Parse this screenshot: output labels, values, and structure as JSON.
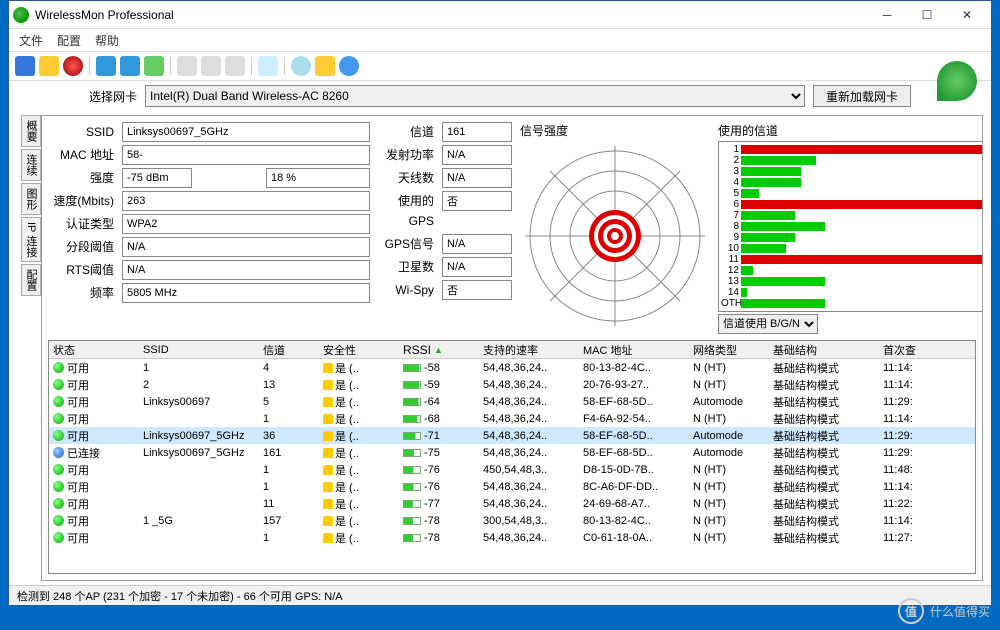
{
  "window": {
    "title": "WirelessMon Professional"
  },
  "menu": {
    "file": "文件",
    "config": "配置",
    "help": "帮助"
  },
  "adapter": {
    "label": "选择网卡",
    "value": "Intel(R) Dual Band Wireless-AC 8260",
    "reload": "重新加载网卡"
  },
  "fields": {
    "ssid_l": "SSID",
    "ssid": "Linksys00697_5GHz",
    "mac_l": "MAC 地址",
    "mac": "58-",
    "str_l": "强度",
    "str": "-75 dBm",
    "str_pct": "18 %",
    "spd_l": "速度(Mbits)",
    "spd": "263",
    "auth_l": "认证类型",
    "auth": "WPA2",
    "frag_l": "分段阈值",
    "frag": "N/A",
    "rts_l": "RTS阈值",
    "rts": "N/A",
    "freq_l": "频率",
    "freq": "5805 MHz",
    "chan_l": "信道",
    "chan": "161",
    "txp_l": "发射功率",
    "txp": "N/A",
    "ant_l": "天线数",
    "ant": "N/A",
    "gps_l": "使用的GPS",
    "gps": "否",
    "gpss_l": "GPS信号",
    "gpss": "N/A",
    "sat_l": "卫星数",
    "sat": "N/A",
    "wispy_l": "Wi-Spy",
    "wispy": "否"
  },
  "groups": {
    "signal": "信号强度",
    "channels": "使用的信道",
    "chmode": "信道使用 B/G/N"
  },
  "chart_data": {
    "type": "bar",
    "title": "使用的信道",
    "xlabel": "",
    "ylabel": "",
    "categories": [
      "1",
      "2",
      "3",
      "4",
      "5",
      "6",
      "7",
      "8",
      "9",
      "10",
      "11",
      "12",
      "13",
      "14",
      "OTH"
    ],
    "values": [
      100,
      25,
      20,
      20,
      6,
      95,
      18,
      28,
      18,
      15,
      98,
      4,
      28,
      2,
      28
    ],
    "colors": [
      "#d00",
      "#0c0",
      "#0c0",
      "#0c0",
      "#0c0",
      "#d00",
      "#0c0",
      "#0c0",
      "#0c0",
      "#0c0",
      "#d00",
      "#0c0",
      "#0c0",
      "#0c0",
      "#0c0"
    ]
  },
  "cols": {
    "status": "状态",
    "ssid": "SSID",
    "chan": "信道",
    "sec": "安全性",
    "rssi": "RSSI",
    "rates": "支持的速率",
    "mac": "MAC 地址",
    "net": "网络类型",
    "infra": "基础结构",
    "first": "首次查"
  },
  "sec_yes": "是 (..",
  "rows": [
    {
      "st": "可用",
      "d": "g",
      "ss": "1",
      "ch": "4",
      "rs": -58,
      "rt": "54,48,36,24..",
      "mac": "80-13-82-4C..",
      "net": "N (HT)",
      "inf": "基础结构模式",
      "t": "11:14:"
    },
    {
      "st": "可用",
      "d": "g",
      "ss": "2",
      "ch": "13",
      "rs": -59,
      "rt": "54,48,36,24..",
      "mac": "20-76-93-27..",
      "net": "N (HT)",
      "inf": "基础结构模式",
      "t": "11:14:"
    },
    {
      "st": "可用",
      "d": "g",
      "ss": "Linksys00697",
      "ch": "5",
      "rs": -64,
      "rt": "54,48,36,24..",
      "mac": "58-EF-68-5D..",
      "net": "Automode",
      "inf": "基础结构模式",
      "t": "11:29:"
    },
    {
      "st": "可用",
      "d": "g",
      "ss": "",
      "ch": "1",
      "rs": -68,
      "rt": "54,48,36,24..",
      "mac": "F4-6A-92-54..",
      "net": "N (HT)",
      "inf": "基础结构模式",
      "t": "11:14:"
    },
    {
      "st": "可用",
      "d": "g",
      "ss": "Linksys00697_5GHz",
      "ch": "36",
      "rs": -71,
      "rt": "54,48,36,24..",
      "mac": "58-EF-68-5D..",
      "net": "Automode",
      "inf": "基础结构模式",
      "t": "11:29:",
      "sel": true
    },
    {
      "st": "已连接",
      "d": "b",
      "ss": "Linksys00697_5GHz",
      "ch": "161",
      "rs": -75,
      "rt": "54,48,36,24..",
      "mac": "58-EF-68-5D..",
      "net": "Automode",
      "inf": "基础结构模式",
      "t": "11:29:"
    },
    {
      "st": "可用",
      "d": "g",
      "ss": "",
      "ch": "1",
      "rs": -76,
      "rt": "450,54,48,3..",
      "mac": "D8-15-0D-7B..",
      "net": "N (HT)",
      "inf": "基础结构模式",
      "t": "11:48:"
    },
    {
      "st": "可用",
      "d": "g",
      "ss": "",
      "ch": "1",
      "rs": -76,
      "rt": "54,48,36,24..",
      "mac": "8C-A6-DF-DD..",
      "net": "N (HT)",
      "inf": "基础结构模式",
      "t": "11:14:"
    },
    {
      "st": "可用",
      "d": "g",
      "ss": "",
      "ch": "11",
      "rs": -77,
      "rt": "54,48,36,24..",
      "mac": "24-69-68-A7..",
      "net": "N (HT)",
      "inf": "基础结构模式",
      "t": "11:22:"
    },
    {
      "st": "可用",
      "d": "g",
      "ss": "1       _5G",
      "ch": "157",
      "rs": -78,
      "rt": "300,54,48,3..",
      "mac": "80-13-82-4C..",
      "net": "N (HT)",
      "inf": "基础结构模式",
      "t": "11:14:"
    },
    {
      "st": "可用",
      "d": "g",
      "ss": "",
      "ch": "1",
      "rs": -78,
      "rt": "54,48,36,24..",
      "mac": "C0-61-18-0A..",
      "net": "N (HT)",
      "inf": "基础结构模式",
      "t": "11:27:"
    }
  ],
  "statusbar": "检测到 248 个AP (231 个加密 - 17 个未加密) - 66 个可用 GPS: N/A",
  "watermark": {
    "c": "值",
    "t": "什么值得买"
  },
  "tabs": {
    "t1": "概要",
    "t2": "连续",
    "t3": "图形",
    "t4": "IP 连接",
    "t5": "配置"
  }
}
